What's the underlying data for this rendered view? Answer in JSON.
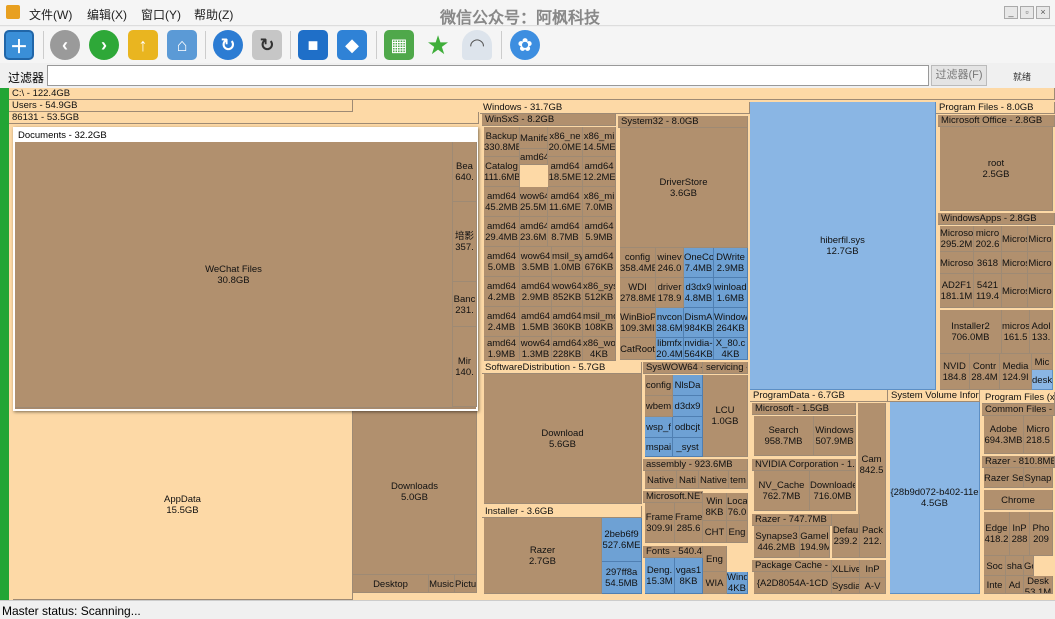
{
  "menu": {
    "items": [
      "文件(W)",
      "编辑(X)",
      "窗口(Y)",
      "帮助(Z)"
    ],
    "watermark": "微信公众号：阿枫科技"
  },
  "filter": {
    "label": "过滤器",
    "value": "",
    "button": "过滤器(F)",
    "status": "就绪"
  },
  "status": {
    "text": "Master status: Scanning..."
  },
  "toolbar": {
    "icons": [
      "new-window-icon",
      "back-icon",
      "forward-icon",
      "folder-up-icon",
      "home-icon",
      "refresh-icon",
      "refresh-page-icon",
      "cube-icon",
      "box-icon",
      "blocks-icon",
      "star-icon",
      "ghost-icon",
      "settings-icon"
    ]
  },
  "colors": {
    "tan": "#b1906e",
    "peach": "#fdd9a6",
    "blue": "#6ea1d4",
    "green": "#22a535"
  },
  "treemap": [
    {
      "n": "C:\\ - 122.4GB"
    },
    {
      "n": "Users - 54.9GB"
    },
    {
      "n": "86131 - 53.5GB"
    },
    {
      "n": "Documents - 32.2GB"
    },
    {
      "n": "WeChat Files\n30.8GB"
    },
    {
      "n": "Bea\n640."
    },
    {
      "n": "培影\n357."
    },
    {
      "n": "Banc\n231."
    },
    {
      "n": "Mir\n140."
    },
    {
      "n": "AppData\n15.5GB"
    },
    {
      "n": "Downloads\n5.0GB"
    },
    {
      "n": "Desktop"
    },
    {
      "n": "Music"
    },
    {
      "n": "Pictu"
    },
    {
      "n": "Windows - 31.7GB"
    },
    {
      "n": "WinSxS - 8.2GB"
    },
    {
      "n": "Backup\n330.8MB"
    },
    {
      "n": "Manife"
    },
    {
      "n": "x86_ne\n20.0ME"
    },
    {
      "n": "x86_mi\n14.5ME"
    },
    {
      "n": "Catalog\n111.6MB"
    },
    {
      "n": "amd64"
    },
    {
      "n": "amd64\n18.5ME"
    },
    {
      "n": "amd64\n12.2ME"
    },
    {
      "n": "amd64\n45.2MB"
    },
    {
      "n": "wow64\n25.5ME"
    },
    {
      "n": "amd64\n11.6ME"
    },
    {
      "n": "x86_mi\n7.0MB"
    },
    {
      "n": "amd64\n29.4MB"
    },
    {
      "n": "amd64\n23.6ME"
    },
    {
      "n": "amd64\n8.7MB"
    },
    {
      "n": "amd64\n5.9MB"
    },
    {
      "n": "amd64\n5.0MB"
    },
    {
      "n": "wow64\n3.5MB"
    },
    {
      "n": "msil_sy\n1.0MB"
    },
    {
      "n": "amd64\n676KB"
    },
    {
      "n": "amd64\n4.2MB"
    },
    {
      "n": "amd64\n2.9MB"
    },
    {
      "n": "wow64\n852KB"
    },
    {
      "n": "x86_sys\n512KB"
    },
    {
      "n": "amd64\n2.4MB"
    },
    {
      "n": "amd64\n1.5MB"
    },
    {
      "n": "amd64\n360KB"
    },
    {
      "n": "msil_mo\n108KB"
    },
    {
      "n": "amd64\n1.9MB"
    },
    {
      "n": "wow64\n1.3MB"
    },
    {
      "n": "amd64\n228KB"
    },
    {
      "n": "x86_wo\n4KB"
    },
    {
      "n": "System32 - 8.0GB"
    },
    {
      "n": "DriverStore\n3.6GB"
    },
    {
      "n": "config\n358.4ME"
    },
    {
      "n": "winev\n246.0"
    },
    {
      "n": "OneCo\n7.4MB"
    },
    {
      "n": "DWrite\n2.9MB"
    },
    {
      "n": "WDI\n278.8ME"
    },
    {
      "n": "driver\n178.9"
    },
    {
      "n": "d3dx9\n4.8MB"
    },
    {
      "n": "winload\n1.6MB"
    },
    {
      "n": "WinBioP\n109.3MI"
    },
    {
      "n": "nvcon\n38.6M"
    },
    {
      "n": "DismA\n984KB"
    },
    {
      "n": "Window\n264KB"
    },
    {
      "n": "CatRoot"
    },
    {
      "n": "libmfx\n20.4M"
    },
    {
      "n": "nvidia-\n564KB"
    },
    {
      "n": "X_80.c\n4KB"
    },
    {
      "n": "hiberfil.sys\n12.7GB"
    },
    {
      "n": "SoftwareDistribution - 5.7GB"
    },
    {
      "n": "Download\n5.6GB"
    },
    {
      "n": "SysWOW64 - 5.4GB"
    },
    {
      "n": "servicing - 1"
    },
    {
      "n": "config"
    },
    {
      "n": "NlsDa"
    },
    {
      "n": "wbem"
    },
    {
      "n": "d3dx9"
    },
    {
      "n": "wsp_f"
    },
    {
      "n": "odbcjt"
    },
    {
      "n": "mspai"
    },
    {
      "n": "_syst"
    },
    {
      "n": "LCU\n1.0GB"
    },
    {
      "n": "assembly - 923.6MB"
    },
    {
      "n": "Native"
    },
    {
      "n": "Nati"
    },
    {
      "n": "Native"
    },
    {
      "n": "tem"
    },
    {
      "n": "Microsoft.NET - "
    },
    {
      "n": "Frame\n309.9I"
    },
    {
      "n": "Frame\n285.6"
    },
    {
      "n": "Win\n8KB"
    },
    {
      "n": "Loca\n76.0"
    },
    {
      "n": "CHT"
    },
    {
      "n": "Eng"
    },
    {
      "n": "Fonts - 540.4MB"
    },
    {
      "n": "Deng.\n15.3M"
    },
    {
      "n": "vgas1\n8KB"
    },
    {
      "n": "Eng"
    },
    {
      "n": "WIA"
    },
    {
      "n": "Wind\n4KB"
    },
    {
      "n": "Installer - 3.6GB"
    },
    {
      "n": "Razer\n2.7GB"
    },
    {
      "n": "2beb6f9\n527.6ME"
    },
    {
      "n": "297ff8a\n54.5MB"
    },
    {
      "n": "ProgramData - 6.7GB"
    },
    {
      "n": "Microsoft - 1.5GB"
    },
    {
      "n": "Search\n958.7MB"
    },
    {
      "n": "Windows\n507.9MB"
    },
    {
      "n": "Cam\n842.5"
    },
    {
      "n": "NVIDIA Corporation - 1.4GB"
    },
    {
      "n": "NV_Cache\n762.7MB"
    },
    {
      "n": "Downloade\n716.0MB"
    },
    {
      "n": "Razer - 747.7MB"
    },
    {
      "n": "Synapse3\n446.2MB"
    },
    {
      "n": "GameI\n194.9M"
    },
    {
      "n": "Defau\n239.2"
    },
    {
      "n": "Pack\n212."
    },
    {
      "n": "Package Cache - 6"
    },
    {
      "n": "{A2D8054A-1CD"
    },
    {
      "n": "XLLive"
    },
    {
      "n": "InP"
    },
    {
      "n": "Sysdia"
    },
    {
      "n": "A-V"
    },
    {
      "n": "System Volume Information - 4.5GB"
    },
    {
      "n": "{28b9d072-b402-11e\n4.5GB"
    },
    {
      "n": "Program Files - 8.0GB"
    },
    {
      "n": "Microsoft Office - 2.8GB"
    },
    {
      "n": "root\n2.5GB"
    },
    {
      "n": "WindowsApps - 2.8GB"
    },
    {
      "n": "Microso\n295.2M"
    },
    {
      "n": "micro\n202.6"
    },
    {
      "n": "Micros"
    },
    {
      "n": "Micro"
    },
    {
      "n": "Microso"
    },
    {
      "n": "3618"
    },
    {
      "n": "Micros"
    },
    {
      "n": "Micro"
    },
    {
      "n": "AD2F1\n181.1M"
    },
    {
      "n": "5421\n119.4"
    },
    {
      "n": "Micros"
    },
    {
      "n": "Micro"
    },
    {
      "n": "Installer2\n706.0MB"
    },
    {
      "n": "micros\n161.5"
    },
    {
      "n": "Adol\n133."
    },
    {
      "n": "NVID\n184.8"
    },
    {
      "n": "Contr\n28.4M"
    },
    {
      "n": "Media\n124.9I"
    },
    {
      "n": "Mic"
    },
    {
      "n": "desk"
    },
    {
      "n": "Program Files (x86) - 5"
    },
    {
      "n": "Common Files - 1"
    },
    {
      "n": "Adobe\n694.3MB"
    },
    {
      "n": "Micro\n218.5"
    },
    {
      "n": "Razer - 810.8MB"
    },
    {
      "n": "Razer Se"
    },
    {
      "n": "Synap"
    },
    {
      "n": "Chrome"
    },
    {
      "n": "Edge\n418.2"
    },
    {
      "n": "InP\n288"
    },
    {
      "n": "Pho\n209"
    },
    {
      "n": "Soc"
    },
    {
      "n": "sha"
    },
    {
      "n": "Goo"
    },
    {
      "n": "Inte"
    },
    {
      "n": "Ad"
    },
    {
      "n": "Desk\n53.1M"
    }
  ]
}
